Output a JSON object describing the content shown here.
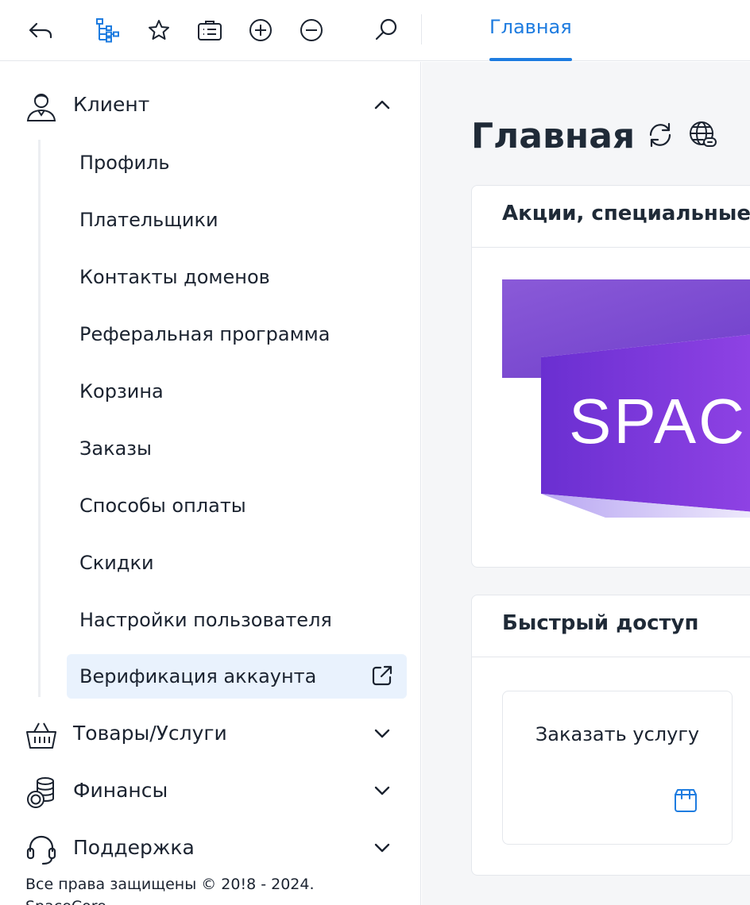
{
  "toolbar": {
    "icons": [
      "back-arrow-icon",
      "tree-structure-icon",
      "star-icon",
      "briefcase-icon",
      "zoom-in-icon",
      "zoom-out-icon",
      "search-icon"
    ],
    "active_tab": "Главная",
    "accent_color": "#1e7ce0"
  },
  "sidebar": {
    "groups": [
      {
        "label": "Клиент",
        "icon": "user-icon",
        "expanded": true,
        "items": [
          {
            "label": "Профиль"
          },
          {
            "label": "Плательщики"
          },
          {
            "label": "Контакты доменов"
          },
          {
            "label": "Реферальная программа"
          },
          {
            "label": "Корзина"
          },
          {
            "label": "Заказы"
          },
          {
            "label": "Способы оплаты"
          },
          {
            "label": "Скидки"
          },
          {
            "label": "Настройки пользователя"
          },
          {
            "label": "Верификация аккаунта",
            "active": true,
            "external": true
          }
        ]
      },
      {
        "label": "Товары/Услуги",
        "icon": "basket-icon",
        "expanded": false
      },
      {
        "label": "Финансы",
        "icon": "coins-icon",
        "expanded": false
      },
      {
        "label": "Поддержка",
        "icon": "headset-icon",
        "expanded": false
      }
    ],
    "copyright_line1": "Все права защищены © 20!8 - 2024.",
    "copyright_line2": "SpaceCore"
  },
  "main": {
    "title": "Главная",
    "title_icons": [
      "refresh-icon",
      "globe-link-icon"
    ],
    "promo_card": {
      "title": "Акции, специальные предложения",
      "banner_text": "SPACE"
    },
    "quick_access": {
      "title": "Быстрый доступ",
      "tiles": [
        {
          "label": "Заказать услугу",
          "icon": "cart-bag-icon"
        }
      ]
    }
  }
}
